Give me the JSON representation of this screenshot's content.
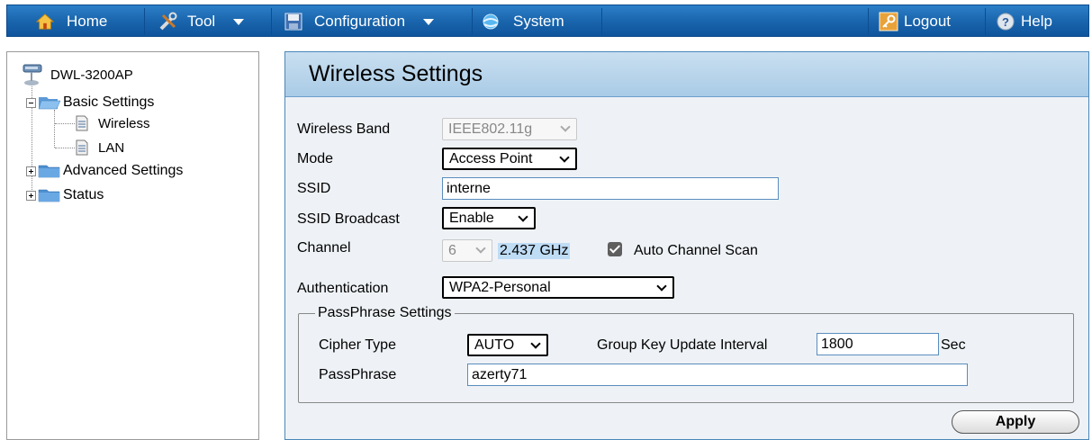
{
  "toolbar": {
    "home": "Home",
    "tool": "Tool",
    "configuration": "Configuration",
    "system": "System",
    "logout": "Logout",
    "help": "Help"
  },
  "tree": {
    "root": "DWL-3200AP",
    "basic_settings": "Basic Settings",
    "wireless": "Wireless",
    "lan": "LAN",
    "advanced_settings": "Advanced Settings",
    "status": "Status"
  },
  "page": {
    "title": "Wireless Settings"
  },
  "form": {
    "wireless_band": {
      "label": "Wireless Band",
      "value": "IEEE802.11g"
    },
    "mode": {
      "label": "Mode",
      "value": "Access Point"
    },
    "ssid": {
      "label": "SSID",
      "value": "interne"
    },
    "ssid_broadcast": {
      "label": "SSID Broadcast",
      "value": "Enable"
    },
    "channel": {
      "label": "Channel",
      "value": "6",
      "frequency": "2.437 GHz",
      "auto_scan_label": "Auto Channel Scan",
      "auto_scan_checked": true
    },
    "authentication": {
      "label": "Authentication",
      "value": "WPA2-Personal"
    },
    "passphrase_settings": {
      "legend": "PassPhrase Settings",
      "cipher_type": {
        "label": "Cipher Type",
        "value": "AUTO"
      },
      "group_key_interval": {
        "label": "Group Key Update Interval",
        "value": "1800",
        "unit": "Sec"
      },
      "passphrase": {
        "label": "PassPhrase",
        "value": "azerty71"
      }
    },
    "apply": "Apply"
  },
  "colors": {
    "toolbar_blue": "#1a66ae",
    "header_blue": "#b9d5ec",
    "frequency_highlight": "#bfdcf5"
  }
}
